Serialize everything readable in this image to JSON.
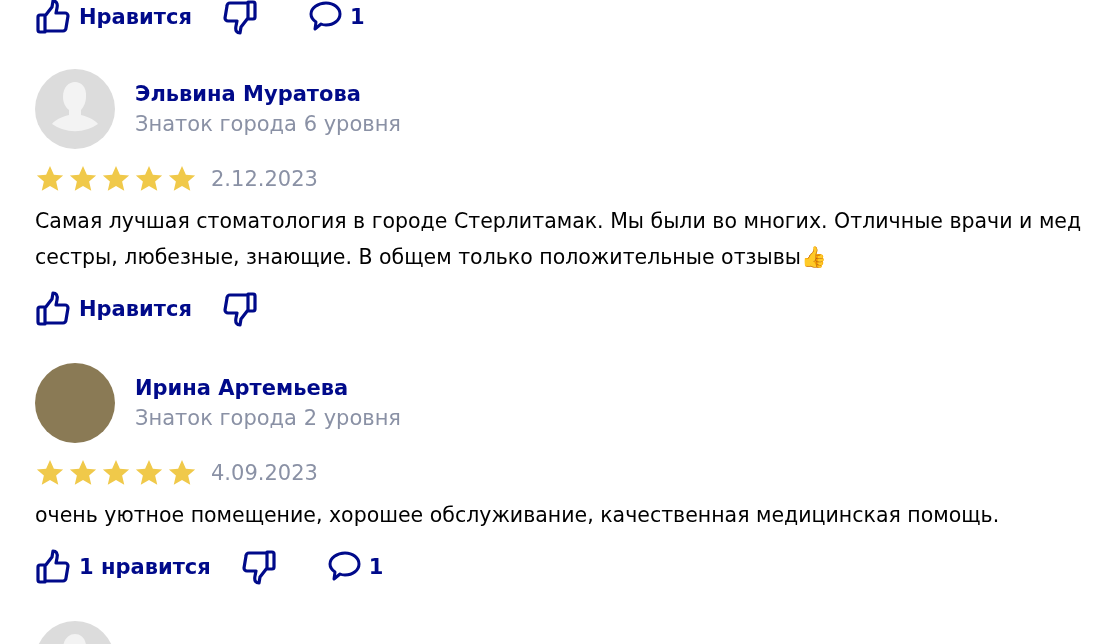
{
  "previous_review": {
    "actions": {
      "like_label": "Нравится",
      "comment_count": "1"
    }
  },
  "reviews": [
    {
      "avatar_photo": false,
      "name": "Эльвина Муратова",
      "level": "Знаток города 6 уровня",
      "stars": 5,
      "date": "2.12.2023",
      "text": "Самая лучшая стоматология в городе Стерлитамак. Мы были во многих. Отличные врачи и мед сестры, любезные, знающие. В общем только положительные отзывы👍",
      "actions": {
        "like_label": "Нравится"
      }
    },
    {
      "avatar_photo": true,
      "name": "Ирина Артемьева",
      "level": "Знаток города 2 уровня",
      "stars": 5,
      "date": "4.09.2023",
      "text": "очень уютное помещение, хорошее обслуживание, качественная медицинская помощь.",
      "actions": {
        "like_label": "1 нравится",
        "comment_count": "1"
      }
    }
  ],
  "next_review": {
    "avatar_photo": false
  }
}
